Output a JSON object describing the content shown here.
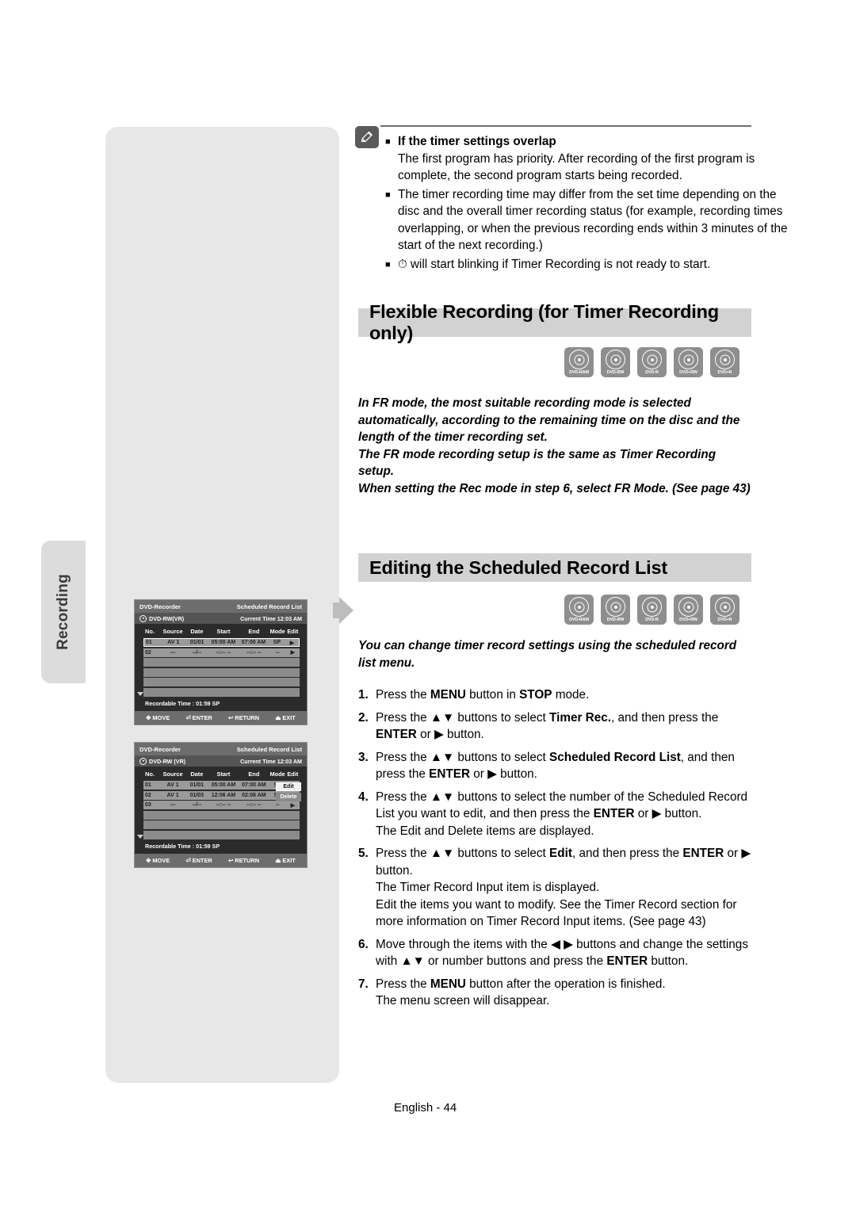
{
  "side_tab": {
    "label": "Recording"
  },
  "note": {
    "icon": "pencil-icon",
    "items": [
      {
        "bullet": "■",
        "title": "If the timer settings overlap",
        "body": "The first program has priority. After recording of the first program is complete, the second program starts being recorded."
      },
      {
        "bullet": "■",
        "title": "",
        "body": "The timer recording time may differ from the set time depending on the disc and the overall timer recording status (for example, recording times overlapping, or when the previous recording ends within 3 minutes of the start of the next recording.)"
      },
      {
        "bullet": "■",
        "title": "",
        "body": "will start blinking if Timer Recording is not ready to start.",
        "lead_glyph": "⏱"
      }
    ]
  },
  "section1": {
    "heading": "Flexible Recording (for Timer Recording only)",
    "logos": [
      "DVD-RAM",
      "DVD-RW",
      "DVD-R",
      "DVD+RW",
      "DVD+R"
    ],
    "intro_lines": [
      "In FR mode, the most suitable recording mode is selected",
      "automatically, according to the remaining time on the disc and the",
      "length of the timer recording set.",
      "The FR mode recording setup is the same as Timer Recording setup.",
      "When setting the Rec mode in step 6, select FR Mode. (See page 43)"
    ]
  },
  "section2": {
    "heading": "Editing the Scheduled Record List",
    "logos": [
      "DVD-RAM",
      "DVD-RW",
      "DVD-R",
      "DVD+RW",
      "DVD+R"
    ],
    "intro_lines": [
      "You can change timer record settings using the scheduled record",
      "list menu."
    ],
    "steps": [
      {
        "num": "1.",
        "parts": [
          {
            "t": "Press the ",
            "b": false
          },
          {
            "t": "MENU",
            "b": true
          },
          {
            "t": " button in ",
            "b": false
          },
          {
            "t": "STOP",
            "b": true
          },
          {
            "t": " mode.",
            "b": false
          }
        ],
        "subs": []
      },
      {
        "num": "2.",
        "parts": [
          {
            "t": "Press the ▲▼ buttons to select ",
            "b": false
          },
          {
            "t": "Timer Rec.",
            "b": true
          },
          {
            "t": ", and then press the ",
            "b": false
          },
          {
            "t": "ENTER",
            "b": true
          },
          {
            "t": " or ▶ button.",
            "b": false
          }
        ],
        "subs": []
      },
      {
        "num": "3.",
        "parts": [
          {
            "t": "Press the ▲▼ buttons to select ",
            "b": false
          },
          {
            "t": "Scheduled Record List",
            "b": true
          },
          {
            "t": ", and then press the ",
            "b": false
          },
          {
            "t": "ENTER",
            "b": true
          },
          {
            "t": " or ▶ button.",
            "b": false
          }
        ],
        "subs": []
      },
      {
        "num": "4.",
        "parts": [
          {
            "t": "Press the ▲▼ buttons to select the number of the Scheduled Record List you want to edit, and then press the ",
            "b": false
          },
          {
            "t": "ENTER",
            "b": true
          },
          {
            "t": " or ▶ button.",
            "b": false
          }
        ],
        "subs": [
          "The Edit and Delete items are displayed."
        ]
      },
      {
        "num": "5.",
        "parts": [
          {
            "t": "Press the ▲▼ buttons to select ",
            "b": false
          },
          {
            "t": "Edit",
            "b": true
          },
          {
            "t": ", and then press the ",
            "b": false
          },
          {
            "t": "ENTER",
            "b": true
          },
          {
            "t": " or ▶ button.",
            "b": false
          }
        ],
        "subs": [
          "The Timer Record Input item is displayed.",
          "Edit the items you want to modify. See the Timer Record section for more information on Timer Record Input items. (See page 43)"
        ]
      },
      {
        "num": "6.",
        "parts": [
          {
            "t": "Move through the items with the ◀ ▶ buttons and change the settings with ▲▼ or number buttons and press the ",
            "b": false
          },
          {
            "t": "ENTER",
            "b": true
          },
          {
            "t": " button.",
            "b": false
          }
        ],
        "subs": []
      },
      {
        "num": "7.",
        "parts": [
          {
            "t": "Press the ",
            "b": false
          },
          {
            "t": "MENU",
            "b": true
          },
          {
            "t": " button after the operation is finished.",
            "b": false
          }
        ],
        "subs": [
          "The menu screen will disappear."
        ]
      }
    ]
  },
  "screens": [
    {
      "id": "screen-1",
      "title_left": "DVD-Recorder",
      "title_right": "Scheduled Record List",
      "disc_label": "DVD-RW(VR)",
      "current_time_label": "Current Time",
      "current_time_value": "12:03 AM",
      "columns": [
        "No.",
        "Source",
        "Date",
        "Start",
        "End",
        "Mode",
        "Edit"
      ],
      "rows": [
        {
          "no": "01",
          "source": "AV 1",
          "date": "01/01",
          "start": "05:00 AM",
          "end": "07:00 AM",
          "mode": "SP",
          "edit": "▶",
          "selected": true
        },
        {
          "no": "02",
          "source": "---",
          "date": "--/--",
          "start": "--:-- --",
          "end": "--:-- --",
          "mode": "--",
          "edit": "▶",
          "selected": false
        }
      ],
      "empty_rows": 4,
      "recordable_time": "Recordable Time : 01:59  SP",
      "footer_buttons": [
        "MOVE",
        "ENTER",
        "RETURN",
        "EXIT"
      ],
      "popup": null
    },
    {
      "id": "screen-2",
      "title_left": "DVD-Recorder",
      "title_right": "Scheduled Record List",
      "disc_label": "DVD-RW (VR)",
      "current_time_label": "Current Time",
      "current_time_value": "12:03 AM",
      "columns": [
        "No.",
        "Source",
        "Date",
        "Start",
        "End",
        "Mode",
        "Edit"
      ],
      "rows": [
        {
          "no": "01",
          "source": "AV 1",
          "date": "01/01",
          "start": "05:00 AM",
          "end": "07:00 AM",
          "mode": "SP",
          "edit": "",
          "selected": false
        },
        {
          "no": "02",
          "source": "AV 1",
          "date": "01/03",
          "start": "12:06 AM",
          "end": "02:06 AM",
          "mode": "SP",
          "edit": "",
          "selected": false
        },
        {
          "no": "03",
          "source": "---",
          "date": "--/--",
          "start": "--:-- --",
          "end": "--:-- --",
          "mode": "--",
          "edit": "▶",
          "selected": false
        }
      ],
      "empty_rows": 3,
      "recordable_time": "Recordable Time : 01:59  SP",
      "footer_buttons": [
        "MOVE",
        "ENTER",
        "RETURN",
        "EXIT"
      ],
      "popup": {
        "items": [
          {
            "label": "Edit",
            "highlighted": true
          },
          {
            "label": "Delete",
            "highlighted": false
          }
        ]
      }
    }
  ],
  "footer": {
    "text": "English - 44"
  },
  "colors": {
    "heading_bar": "#d2d2d2",
    "panel": "#e7e7e7",
    "tab": "#dcdcdc",
    "logo": "#8e8e8e",
    "screen_bg": "#2b2b2b",
    "arrow": "#bdbdbd"
  }
}
